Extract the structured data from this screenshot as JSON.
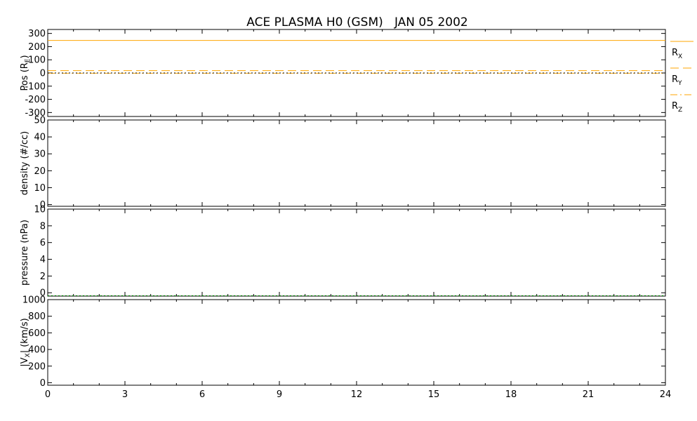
{
  "chart_data": {
    "type": "line",
    "title": "ACE PLASMA H0 (GSM)   JAN 05 2002",
    "xlim": [
      0,
      24
    ],
    "x_ticks": [
      0,
      3,
      6,
      9,
      12,
      15,
      18,
      21,
      24
    ],
    "x_tick_labels": [
      "0",
      "3",
      "6",
      "9",
      "12",
      "15",
      "18",
      "21",
      "24"
    ],
    "grid": false,
    "legend_position": "right of top panel",
    "panels": [
      {
        "id": "pos",
        "ylabel_main": "Pos (R",
        "ylabel_sub": "E",
        "ylabel_tail": ")",
        "ylim": [
          -330,
          330
        ],
        "y_ticks": [
          300,
          200,
          100,
          0,
          -100,
          -200,
          -300
        ],
        "y_tick_labels": [
          "300",
          "200",
          "100",
          "0",
          "-100",
          "-200",
          "-300"
        ],
        "series": [
          {
            "name": "X",
            "label_main": "R",
            "label_sub": "X",
            "color": "#ffa500",
            "dash": "solid",
            "x": [
              0,
              24
            ],
            "y": [
              247,
              247
            ]
          },
          {
            "name": "Y",
            "label_main": "R",
            "label_sub": "Y",
            "color": "#ffa500",
            "dash": "dash",
            "x": [
              0,
              24
            ],
            "y": [
              18,
              18
            ]
          },
          {
            "name": "Z",
            "label_main": "R",
            "label_sub": "Z",
            "color": "#ffa500",
            "dash": "dashdot",
            "x": [
              0,
              24
            ],
            "y": [
              -2,
              -2
            ]
          },
          {
            "name": "zero",
            "color": "#000000",
            "dash": "dot",
            "x": [
              0,
              24
            ],
            "y": [
              0,
              0
            ]
          }
        ]
      },
      {
        "id": "density",
        "ylabel_main": "density (#/cc)",
        "ylim": [
          -1,
          50
        ],
        "y_ticks": [
          50,
          40,
          30,
          20,
          10,
          0
        ],
        "y_tick_labels": [
          "50",
          "40",
          "30",
          "20",
          "10",
          "0"
        ],
        "series": []
      },
      {
        "id": "pressure",
        "ylabel_main": "pressure (nPa)",
        "ylim": [
          -0.4,
          10
        ],
        "y_ticks": [
          10,
          8,
          6,
          4,
          2,
          0
        ],
        "y_tick_labels": [
          "10",
          "8",
          "6",
          "4",
          "2",
          "0"
        ],
        "series": [
          {
            "name": "pressure",
            "color": "#00a000",
            "dash": "dot",
            "x": [
              0,
              24
            ],
            "y": [
              -0.35,
              -0.35
            ]
          }
        ]
      },
      {
        "id": "vx",
        "ylabel_main": "|V",
        "ylabel_sub": "X",
        "ylabel_tail": "| (km/s)",
        "ylim": [
          -30,
          1000
        ],
        "y_ticks": [
          1000,
          800,
          600,
          400,
          200,
          0
        ],
        "y_tick_labels": [
          "1000",
          "800",
          "600",
          "400",
          "200",
          "0"
        ],
        "series": []
      }
    ]
  }
}
